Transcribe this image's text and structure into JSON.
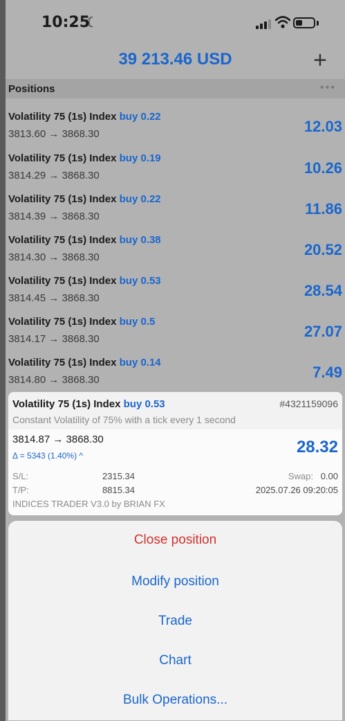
{
  "status_bar": {
    "time": "10:25"
  },
  "header": {
    "balance": "39 213.46 USD",
    "add_label": "+"
  },
  "positions": {
    "title": "Positions",
    "menu_label": "•••",
    "items": [
      {
        "symbol": "Volatility 75 (1s) Index",
        "direction": "buy 0.22",
        "prices": "3813.60 → 3868.30",
        "profit": "12.03"
      },
      {
        "symbol": "Volatility 75 (1s) Index",
        "direction": "buy 0.19",
        "prices": "3814.29 → 3868.30",
        "profit": "10.26"
      },
      {
        "symbol": "Volatility 75 (1s) Index",
        "direction": "buy 0.22",
        "prices": "3814.39 → 3868.30",
        "profit": "11.86"
      },
      {
        "symbol": "Volatility 75 (1s) Index",
        "direction": "buy 0.38",
        "prices": "3814.30 → 3868.30",
        "profit": "20.52"
      },
      {
        "symbol": "Volatility 75 (1s) Index",
        "direction": "buy 0.53",
        "prices": "3814.45 → 3868.30",
        "profit": "28.54"
      },
      {
        "symbol": "Volatility 75 (1s) Index",
        "direction": "buy 0.5",
        "prices": "3814.17 → 3868.30",
        "profit": "27.07"
      },
      {
        "symbol": "Volatility 75 (1s) Index",
        "direction": "buy 0.14",
        "prices": "3814.80 → 3868.30",
        "profit": "7.49"
      }
    ]
  },
  "detail": {
    "symbol": "Volatility 75 (1s) Index",
    "direction": "buy 0.53",
    "ticket": "#4321159096",
    "description": "Constant Volatility of 75% with a tick every 1 second",
    "prices": "3814.87 → 3868.30",
    "delta": "Δ = 5343 (1.40%) ^",
    "profit": "28.32",
    "sl_label": "S/L:",
    "sl_value": "2315.34",
    "tp_label": "T/P:",
    "tp_value": "8815.34",
    "swap_label": "Swap:",
    "swap_value": "0.00",
    "time": "2025.07.26 09:20:05",
    "comment": "INDICES TRADER V3.0 by BRIAN FX"
  },
  "actions": {
    "close": "Close position",
    "modify": "Modify position",
    "trade": "Trade",
    "chart": "Chart",
    "bulk": "Bulk Operations..."
  },
  "colors": {
    "accent": "#1a66cc",
    "danger": "#d0342c",
    "dimmed_background": "#b2b2b2",
    "sheet": "#f2f2f2"
  },
  "icons": [
    "moon-icon",
    "signal-icon",
    "wifi-icon",
    "battery-icon",
    "plus-icon",
    "more-icon",
    "chevron-up-icon"
  ]
}
